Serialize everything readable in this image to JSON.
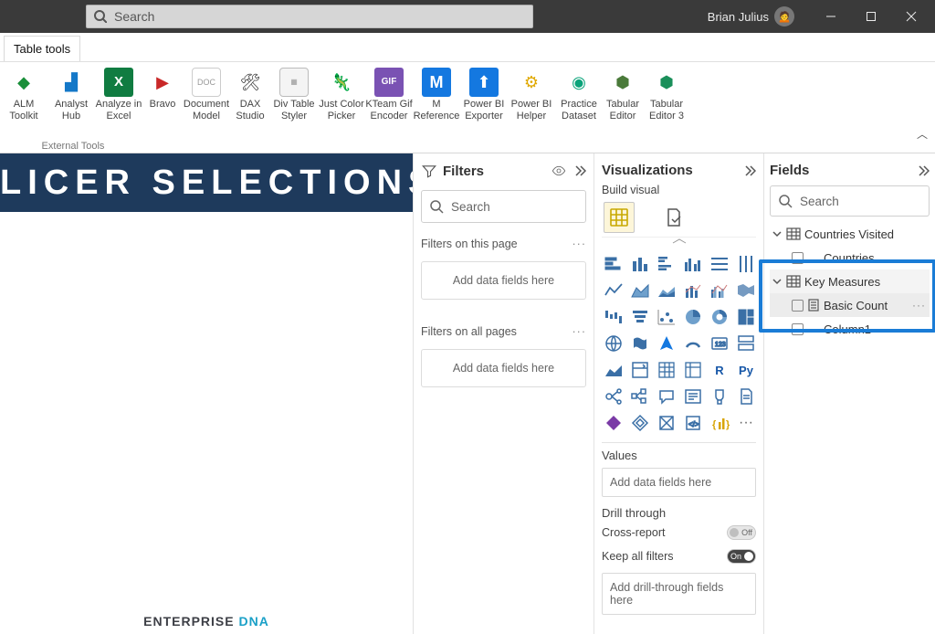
{
  "titlebar": {
    "search_placeholder": "Search",
    "username": "Brian Julius"
  },
  "tabstrip": {
    "active_tab": "Table tools"
  },
  "ribbon": {
    "group_label": "External Tools",
    "items": [
      {
        "label": "ALM Toolkit"
      },
      {
        "label": "Analyst Hub"
      },
      {
        "label": "Analyze in Excel"
      },
      {
        "label": "Bravo"
      },
      {
        "label": "Document Model"
      },
      {
        "label": "DAX Studio"
      },
      {
        "label": "Div Table Styler"
      },
      {
        "label": "Just Color Picker"
      },
      {
        "label": "KTeam Gif Encoder"
      },
      {
        "label": "M Reference"
      },
      {
        "label": "Power BI Exporter"
      },
      {
        "label": "Power BI Helper"
      },
      {
        "label": "Practice Dataset"
      },
      {
        "label": "Tabular Editor"
      },
      {
        "label": "Tabular Editor 3"
      }
    ]
  },
  "canvas": {
    "banner_text": "LICER SELECTIONS",
    "brand_a": "ENTERPRISE",
    "brand_b": "DNA"
  },
  "filters": {
    "title": "Filters",
    "search_placeholder": "Search",
    "section_page": "Filters on this page",
    "section_all": "Filters on all pages",
    "drop_text": "Add data fields here"
  },
  "viz": {
    "title": "Visualizations",
    "subtitle": "Build visual",
    "values_title": "Values",
    "values_drop": "Add data fields here",
    "drill_title": "Drill through",
    "cross_report": "Cross-report",
    "cross_report_state": "Off",
    "keep_filters": "Keep all filters",
    "keep_filters_state": "On",
    "drill_drop": "Add drill-through fields here",
    "r_label": "R",
    "py_label": "Py",
    "ellipsis": "···"
  },
  "fields": {
    "title": "Fields",
    "search_placeholder": "Search",
    "tables": [
      {
        "name": "Countries Visited",
        "expanded": true,
        "children": [
          {
            "name": "Countries",
            "type": "column"
          }
        ]
      },
      {
        "name": "Key Measures",
        "expanded": true,
        "children": [
          {
            "name": "Basic Count",
            "type": "measure",
            "selected": true
          }
        ]
      },
      {
        "name_partial": "Column1"
      }
    ]
  }
}
